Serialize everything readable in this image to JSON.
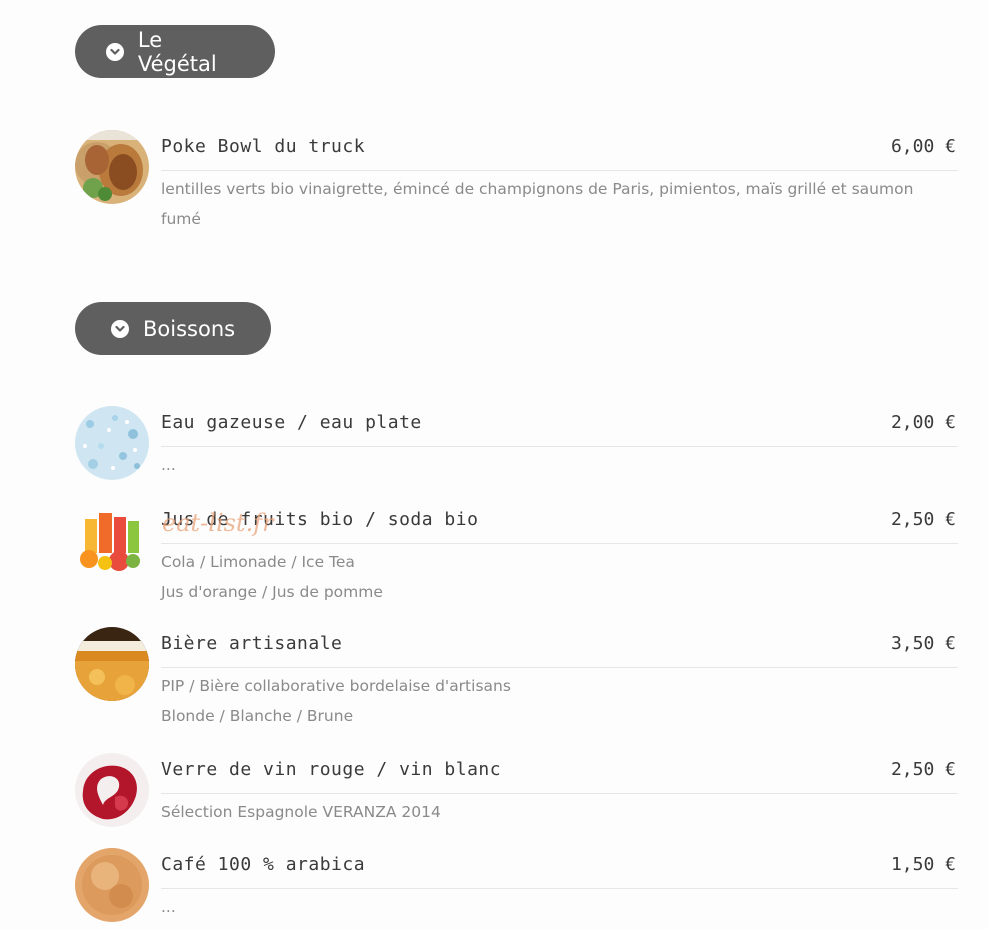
{
  "sections": [
    {
      "label": "Le Végétal",
      "items": [
        {
          "name": "Poke Bowl du truck",
          "price": "6,00 €",
          "desc": [
            "lentilles verts bio vinaigrette, émincé de champignons de Paris, pimientos, maïs grillé et saumon fumé"
          ],
          "image": "wrap-photo"
        }
      ]
    },
    {
      "label": "Boissons",
      "items": [
        {
          "name": "Eau gazeuse / eau plate",
          "price": "2,00 €",
          "desc": [
            "..."
          ],
          "image": "water-photo"
        },
        {
          "name": "Jus de fruits bio / soda bio",
          "price": "2,50 €",
          "desc": [
            "Cola / Limonade / Ice Tea",
            "Jus d'orange / Jus de pomme"
          ],
          "image": "juice-photo"
        },
        {
          "name": "Bière artisanale",
          "price": "3,50 €",
          "desc": [
            "PIP / Bière collaborative bordelaise d'artisans",
            "Blonde / Blanche / Brune"
          ],
          "image": "beer-photo"
        },
        {
          "name": "Verre de vin rouge / vin blanc",
          "price": "2,50 €",
          "desc": [
            "Sélection Espagnole VERANZA 2014"
          ],
          "image": "wine-photo"
        },
        {
          "name": "Café 100 % arabica",
          "price": "1,50 €",
          "desc": [
            "..."
          ],
          "image": "coffee-photo"
        }
      ]
    }
  ],
  "watermark": "eat-list.fr"
}
